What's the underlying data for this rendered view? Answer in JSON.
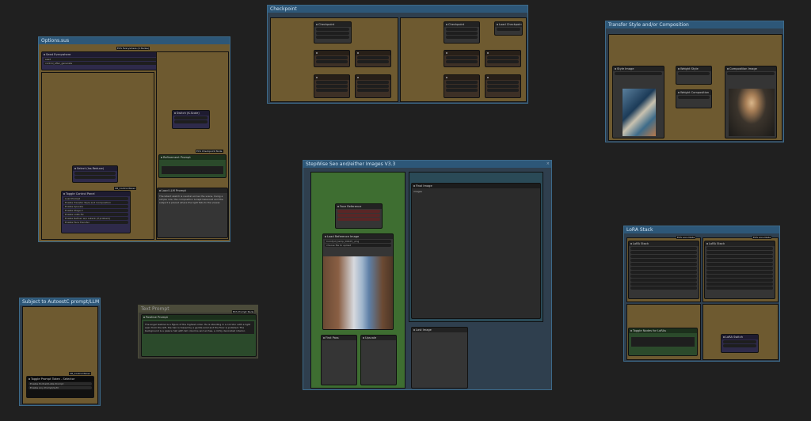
{
  "groups": {
    "options": "Options.sus",
    "checkpoints": "Checkpoint",
    "transfer": "Transfer Style and/or Composition",
    "stepwise": "StepWise Seo and/either Images V3.3",
    "lora": "LoRA Stack",
    "subject": "Subject to AutoestC prompt/LLM",
    "prompt": "Text Prompt"
  },
  "nodes": {
    "seed": "Seed Everywhere",
    "seed_badge": "ECS Everywhere (4 Nodes)",
    "seed_row1": "seed",
    "seed_row2": "control_after_generate",
    "vae": "Switch (K-Scale)",
    "select_txt": "Select (Iss.Reduce)",
    "toggle_ctrl": "Toggle Control Panel",
    "toggle_badge": "CR_Control Panel",
    "toggle_items": [
      "Load Prompt",
      "Enable Transfer Style and Composition",
      "Enable Upscale",
      "Enable Stage 2",
      "Enable LoRA Fix",
      "Enable Refiner w/o Latent (if problem)",
      "Enable Face Transfer"
    ],
    "ref_prompt": "Refinement Prompt",
    "ref_badge": "ECS Checkpoint Node",
    "llm_prompt": "Load LLM Prompt",
    "llm_text": "The latent sketch is neutral across the scene. Using a simple rule, the composition is kept balanced and the subject is placed where the light falls to the viewer.",
    "ckpt_a": "Checkpoint",
    "ckpt_b": "Checkpoint",
    "ckpt_c": "Load Checkpoint",
    "style_img": "Style Image",
    "weight_style": "Weight Style",
    "weight_comp": "Weight Composition",
    "comp_img": "Composition Image",
    "face_badge": "Face Reference",
    "load_ref": "Load Reference Image",
    "ref_file": "ComfyUI_temp_00025_.png",
    "choose": "choose file to upload",
    "final_image": "Final Image",
    "final_row": "images",
    "first_pass": "First Pass",
    "upscale": "Upscale",
    "last_img": "Last Image",
    "lora_a": "LoRA Stack",
    "lora_b": "LoRA Stack",
    "lora_badge": "ECS Lora Node",
    "lora_toggle": "Toggle Nodes for LoRAs",
    "lora_select": "LoRA Switch",
    "positive_prompt": "Positive Prompt",
    "prompt_badge": "ECS Prompt Node",
    "prompt_text": "The angel Gabriel is a figure of the highest order. He is standing in a corridor with a light seen from the left, the hair is tossed by a gentle wind and the floor is polished. The background is a palace hall with tall columns and arches, a richly decorated interior.",
    "toggle_prompt": "Toggle Prompt Token - Selector",
    "toggle_prompt_badge": "CR_Control Panel",
    "toggle_prompt_items": [
      "Enable Portrait/LoRa Prompt",
      "Enable Any Prompt/LLM"
    ]
  },
  "colors": {
    "group_head": "#2d5778",
    "group_body": "#6e5a30",
    "canvas": "#202020",
    "selected": "#3e6e31"
  }
}
